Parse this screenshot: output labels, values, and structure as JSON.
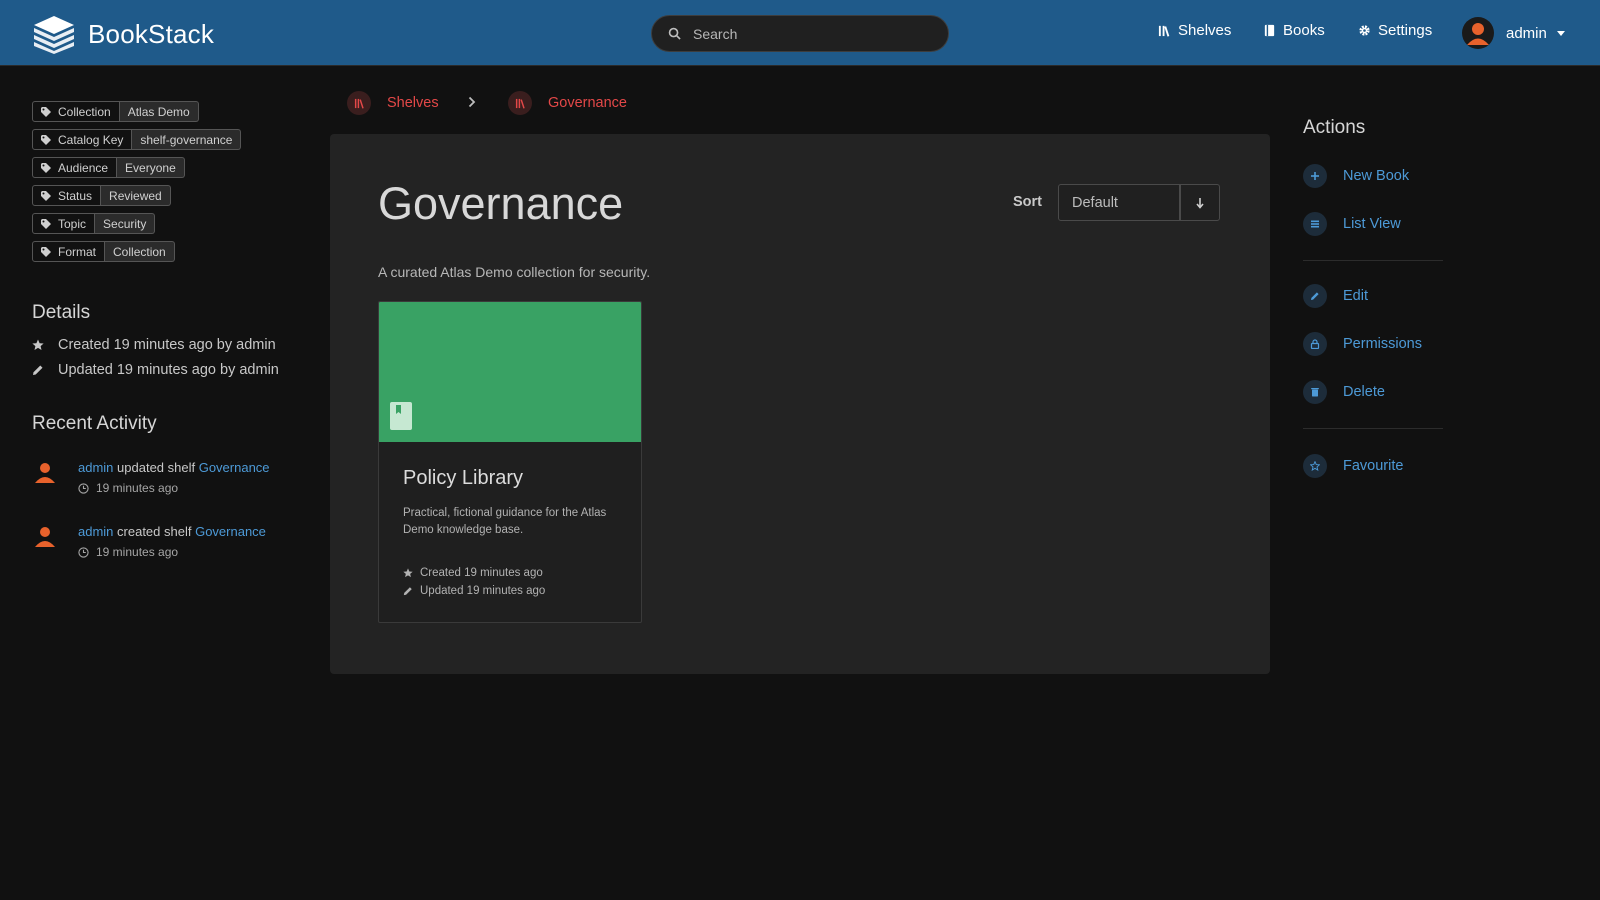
{
  "app": {
    "name": "BookStack"
  },
  "search": {
    "placeholder": "Search"
  },
  "nav": {
    "shelves": "Shelves",
    "books": "Books",
    "settings": "Settings"
  },
  "user": {
    "name": "admin"
  },
  "tags": [
    {
      "key": "Collection",
      "value": "Atlas Demo"
    },
    {
      "key": "Catalog Key",
      "value": "shelf-governance"
    },
    {
      "key": "Audience",
      "value": "Everyone"
    },
    {
      "key": "Status",
      "value": "Reviewed"
    },
    {
      "key": "Topic",
      "value": "Security"
    },
    {
      "key": "Format",
      "value": "Collection"
    }
  ],
  "details": {
    "title": "Details",
    "created": "Created 19 minutes ago by admin",
    "updated": "Updated 19 minutes ago by admin"
  },
  "recent_activity": {
    "title": "Recent Activity",
    "items": [
      {
        "user": "admin",
        "action": " updated shelf ",
        "target": "Governance",
        "time": "19 minutes ago"
      },
      {
        "user": "admin",
        "action": " created shelf ",
        "target": "Governance",
        "time": "19 minutes ago"
      }
    ]
  },
  "breadcrumbs": {
    "shelves": "Shelves",
    "current": "Governance"
  },
  "shelf": {
    "title": "Governance",
    "description": "A curated Atlas Demo collection for security.",
    "sort_label": "Sort",
    "sort_value": "Default"
  },
  "book": {
    "title": "Policy Library",
    "description": "Practical, fictional guidance for the Atlas Demo knowledge base.",
    "created": "Created 19 minutes ago",
    "updated": "Updated 19 minutes ago",
    "cover_color": "#39a264"
  },
  "actions": {
    "title": "Actions",
    "new_book": "New Book",
    "list_view": "List View",
    "edit": "Edit",
    "permissions": "Permissions",
    "delete": "Delete",
    "favourite": "Favourite"
  },
  "colors": {
    "header": "#1f5a8a",
    "link": "#4d9ad7",
    "shelf_accent": "#e34848",
    "background": "#111111"
  }
}
